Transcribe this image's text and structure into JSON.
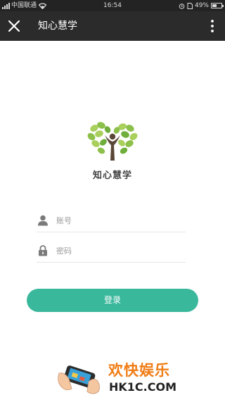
{
  "status_bar": {
    "carrier": "中国联通",
    "time": "16:54",
    "battery_percent": "49%",
    "battery_level": 0.49,
    "icons": [
      "signal-icon",
      "wifi-icon",
      "alarm-icon",
      "sim-icon",
      "battery-icon"
    ]
  },
  "header": {
    "title": "知心慧学",
    "close_icon": "close-icon",
    "more_icon": "more-vertical-icon"
  },
  "brand": {
    "name": "知心慧学",
    "logo_icon": "tree-person-logo",
    "colors": {
      "leaf_light": "#a9cf5c",
      "leaf_dark": "#6fae3a",
      "trunk": "#5a4636"
    }
  },
  "form": {
    "username": {
      "placeholder": "账号",
      "value": "",
      "icon": "user-icon"
    },
    "password": {
      "placeholder": "密码",
      "value": "",
      "icon": "lock-icon"
    },
    "submit_label": "登录",
    "accent": "#3ab89c"
  },
  "watermark": {
    "line1": "欢快娱乐",
    "line2": "HK1C.COM"
  }
}
